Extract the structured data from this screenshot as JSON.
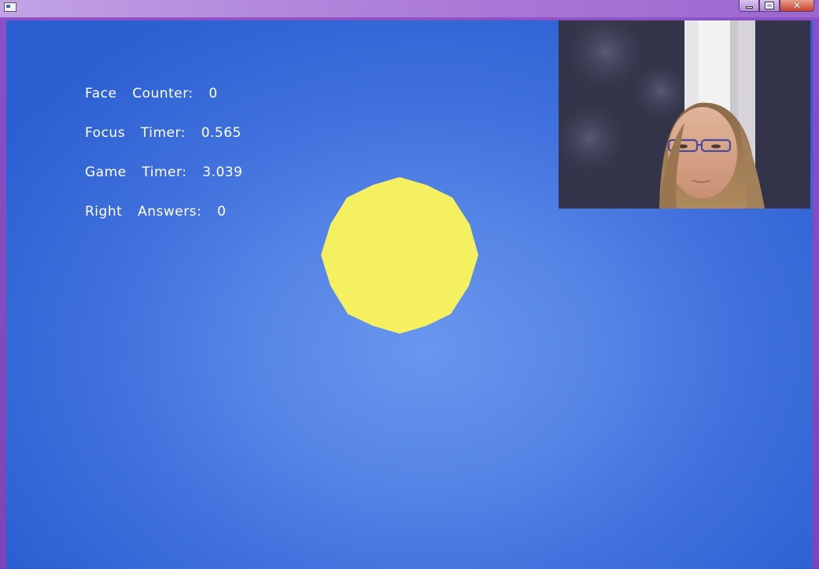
{
  "window": {
    "controls": {
      "minimize_icon": "minimize-icon",
      "maximize_icon": "maximize-icon",
      "close_icon": "close-icon",
      "close_glyph": "✕"
    }
  },
  "game": {
    "background_color": "#5585e6",
    "target_shape": {
      "kind": "octagon-circle",
      "color": "#f5f060"
    },
    "hud": {
      "face_counter": "Face  Counter:  0",
      "focus_timer": "Focus  Timer:  0.565",
      "game_timer": "Game  Timer:  3.039",
      "right_answers": "Right  Answers:  0"
    },
    "webcam_preview": {
      "subject": "person with glasses"
    }
  }
}
